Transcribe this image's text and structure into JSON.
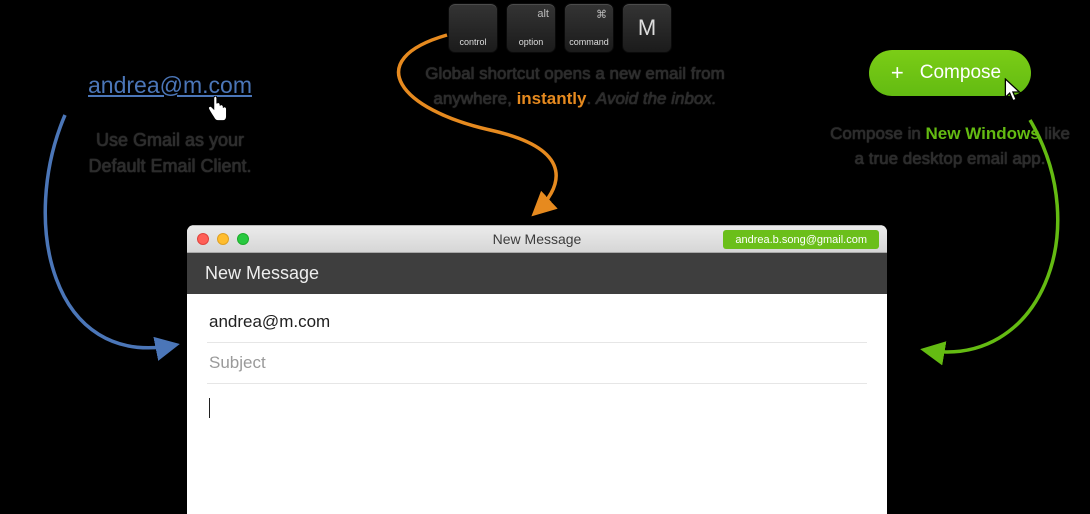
{
  "mailto": {
    "link_text": "andrea@m.com",
    "caption_line1": "Use Gmail as your",
    "caption_line2": "Default Email Client."
  },
  "keys": {
    "k1": {
      "label": "control",
      "symbol": ""
    },
    "k2": {
      "label": "option",
      "symbol": "alt"
    },
    "k3": {
      "label": "command",
      "symbol": "⌘"
    },
    "k4": {
      "letter": "M"
    }
  },
  "shortcut_caption": {
    "part1": "Global shortcut opens a new email from anywhere, ",
    "highlight": "instantly",
    "part2": ". ",
    "italic": "Avoid the inbox."
  },
  "compose": {
    "button_label": "Compose",
    "caption_part1": "Compose in ",
    "caption_highlight": "New Windows",
    "caption_part2": " like a true desktop email app."
  },
  "window": {
    "title": "New Message",
    "account": "andrea.b.song@gmail.com",
    "header": "New Message",
    "to_value": "andrea@m.com",
    "subject_placeholder": "Subject"
  },
  "icons": {
    "plus": "+"
  },
  "colors": {
    "link": "#4b76b8",
    "orange": "#e68a1f",
    "green": "#64bb12"
  }
}
